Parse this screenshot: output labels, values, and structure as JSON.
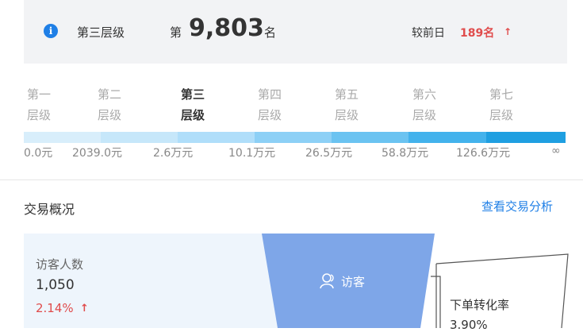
{
  "rank_card": {
    "level_name": "第三层级",
    "rank_prefix": "第",
    "rank_number": "9,803",
    "rank_suffix": "名",
    "compare_label": "较前日",
    "compare_value": "189名",
    "compare_arrow": "↑",
    "info_icon": "i"
  },
  "tiers": {
    "labels": [
      {
        "line1": "第一",
        "line2": "层级"
      },
      {
        "line1": "第二",
        "line2": "层级"
      },
      {
        "line1": "第三",
        "line2": "层级"
      },
      {
        "line1": "第四",
        "line2": "层级"
      },
      {
        "line1": "第五",
        "line2": "层级"
      },
      {
        "line1": "第六",
        "line2": "层级"
      },
      {
        "line1": "第七",
        "line2": "层级"
      }
    ],
    "active_index": 2,
    "bar_colors": [
      "#d8eefb",
      "#c6e7fa",
      "#b0defa",
      "#8dd0f6",
      "#6bc3f1",
      "#43b2ec",
      "#1f9fe1"
    ],
    "thresholds": [
      "0.0元",
      "2039.0元",
      "2.6万元",
      "10.1万元",
      "26.5万元",
      "58.8万元",
      "126.6万元",
      "∞"
    ]
  },
  "section": {
    "title": "交易概况",
    "link": "查看交易分析"
  },
  "visitor": {
    "label": "访客人数",
    "count": "1,050",
    "change": "2.14%",
    "arrow": "↑"
  },
  "funnel": {
    "label": "访客",
    "icon": "user-icon",
    "color": "#7ea6e8"
  },
  "conversion": {
    "label": "下单转化率",
    "value": "3.90%"
  }
}
